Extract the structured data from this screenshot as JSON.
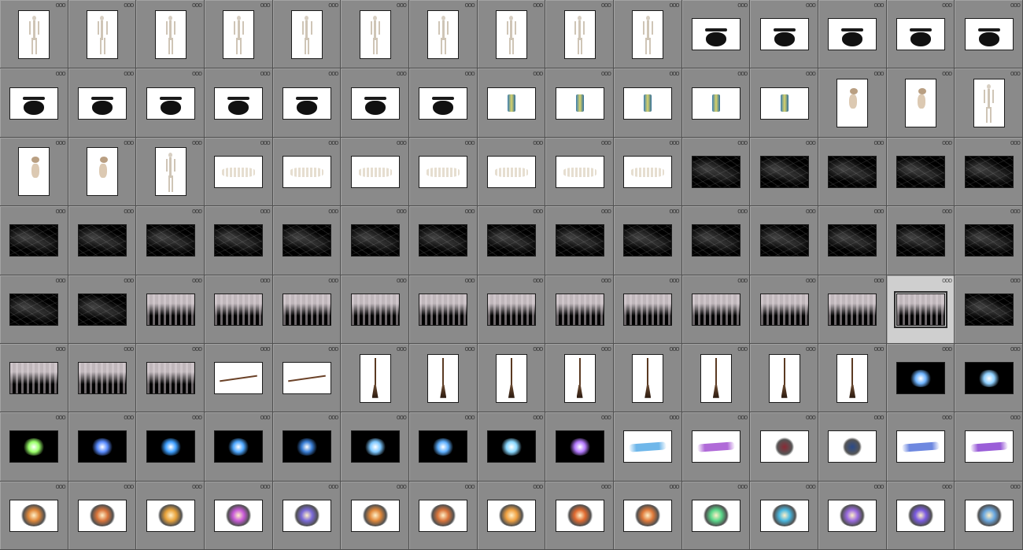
{
  "grid": {
    "columns": 15,
    "rows": 8,
    "menu_glyph": "ooo",
    "selected_index": 73
  },
  "thumbnails": [
    {
      "kind": "skeleton",
      "orient": "portrait",
      "bg": "white"
    },
    {
      "kind": "skeleton",
      "orient": "portrait",
      "bg": "white"
    },
    {
      "kind": "skeleton",
      "orient": "portrait",
      "bg": "white"
    },
    {
      "kind": "skeleton",
      "orient": "portrait",
      "bg": "white"
    },
    {
      "kind": "skeleton",
      "orient": "portrait",
      "bg": "white"
    },
    {
      "kind": "skeleton",
      "orient": "portrait",
      "bg": "white"
    },
    {
      "kind": "skeleton",
      "orient": "portrait",
      "bg": "white"
    },
    {
      "kind": "skeleton",
      "orient": "portrait",
      "bg": "white"
    },
    {
      "kind": "skeleton",
      "orient": "portrait",
      "bg": "white"
    },
    {
      "kind": "skeleton",
      "orient": "portrait",
      "bg": "white"
    },
    {
      "kind": "cauldron",
      "orient": "landscape",
      "bg": "white"
    },
    {
      "kind": "cauldron",
      "orient": "landscape",
      "bg": "white"
    },
    {
      "kind": "cauldron",
      "orient": "landscape",
      "bg": "white"
    },
    {
      "kind": "cauldron",
      "orient": "landscape",
      "bg": "white"
    },
    {
      "kind": "cauldron",
      "orient": "landscape",
      "bg": "white"
    },
    {
      "kind": "cauldron",
      "orient": "landscape",
      "bg": "white"
    },
    {
      "kind": "cauldron",
      "orient": "landscape",
      "bg": "white"
    },
    {
      "kind": "cauldron",
      "orient": "landscape",
      "bg": "white"
    },
    {
      "kind": "cauldron",
      "orient": "landscape",
      "bg": "white"
    },
    {
      "kind": "cauldron",
      "orient": "landscape",
      "bg": "white"
    },
    {
      "kind": "cauldron",
      "orient": "landscape",
      "bg": "white"
    },
    {
      "kind": "cauldron",
      "orient": "landscape",
      "bg": "white"
    },
    {
      "kind": "lantern",
      "orient": "landscape",
      "bg": "white"
    },
    {
      "kind": "lantern",
      "orient": "landscape",
      "bg": "white"
    },
    {
      "kind": "lantern",
      "orient": "landscape",
      "bg": "white"
    },
    {
      "kind": "lantern",
      "orient": "landscape",
      "bg": "white"
    },
    {
      "kind": "lantern",
      "orient": "landscape",
      "bg": "white"
    },
    {
      "kind": "bird-skeleton",
      "orient": "portrait",
      "bg": "white"
    },
    {
      "kind": "bird-skeleton",
      "orient": "portrait",
      "bg": "white"
    },
    {
      "kind": "skeleton",
      "orient": "portrait",
      "bg": "white"
    },
    {
      "kind": "bird-skeleton",
      "orient": "portrait",
      "bg": "white"
    },
    {
      "kind": "bird-skeleton",
      "orient": "portrait",
      "bg": "white"
    },
    {
      "kind": "skeleton",
      "orient": "portrait",
      "bg": "white"
    },
    {
      "kind": "dog-skeleton",
      "orient": "landscape",
      "bg": "white"
    },
    {
      "kind": "dog-skeleton",
      "orient": "landscape",
      "bg": "white"
    },
    {
      "kind": "dog-skeleton",
      "orient": "landscape",
      "bg": "white"
    },
    {
      "kind": "dog-skeleton",
      "orient": "landscape",
      "bg": "white"
    },
    {
      "kind": "dog-skeleton",
      "orient": "landscape",
      "bg": "white"
    },
    {
      "kind": "dog-skeleton",
      "orient": "landscape",
      "bg": "white"
    },
    {
      "kind": "dog-skeleton",
      "orient": "landscape",
      "bg": "white"
    },
    {
      "kind": "cobweb",
      "orient": "landscape",
      "bg": "black"
    },
    {
      "kind": "cobweb",
      "orient": "landscape",
      "bg": "black"
    },
    {
      "kind": "cobweb",
      "orient": "landscape",
      "bg": "black"
    },
    {
      "kind": "cobweb",
      "orient": "landscape",
      "bg": "black"
    },
    {
      "kind": "cobweb",
      "orient": "landscape",
      "bg": "black"
    },
    {
      "kind": "cobweb",
      "orient": "landscape",
      "bg": "black"
    },
    {
      "kind": "cobweb",
      "orient": "landscape",
      "bg": "black"
    },
    {
      "kind": "cobweb",
      "orient": "landscape",
      "bg": "black"
    },
    {
      "kind": "cobweb",
      "orient": "landscape",
      "bg": "black"
    },
    {
      "kind": "cobweb",
      "orient": "landscape",
      "bg": "black"
    },
    {
      "kind": "cobweb",
      "orient": "landscape",
      "bg": "black"
    },
    {
      "kind": "cobweb",
      "orient": "landscape",
      "bg": "black"
    },
    {
      "kind": "cobweb",
      "orient": "landscape",
      "bg": "black"
    },
    {
      "kind": "cobweb",
      "orient": "landscape",
      "bg": "black"
    },
    {
      "kind": "cobweb",
      "orient": "landscape",
      "bg": "black"
    },
    {
      "kind": "cobweb",
      "orient": "landscape",
      "bg": "black"
    },
    {
      "kind": "cobweb",
      "orient": "landscape",
      "bg": "black"
    },
    {
      "kind": "cobweb",
      "orient": "landscape",
      "bg": "black"
    },
    {
      "kind": "cobweb",
      "orient": "landscape",
      "bg": "black"
    },
    {
      "kind": "cobweb",
      "orient": "landscape",
      "bg": "black"
    },
    {
      "kind": "cobweb",
      "orient": "landscape",
      "bg": "black"
    },
    {
      "kind": "cobweb",
      "orient": "landscape",
      "bg": "black"
    },
    {
      "kind": "cheesecloth",
      "orient": "landscape",
      "bg": "black"
    },
    {
      "kind": "cheesecloth",
      "orient": "landscape",
      "bg": "black"
    },
    {
      "kind": "cheesecloth",
      "orient": "landscape",
      "bg": "black"
    },
    {
      "kind": "cheesecloth",
      "orient": "landscape",
      "bg": "black"
    },
    {
      "kind": "cheesecloth",
      "orient": "landscape",
      "bg": "black"
    },
    {
      "kind": "cheesecloth",
      "orient": "landscape",
      "bg": "black"
    },
    {
      "kind": "cheesecloth",
      "orient": "landscape",
      "bg": "black"
    },
    {
      "kind": "cheesecloth",
      "orient": "landscape",
      "bg": "black"
    },
    {
      "kind": "cheesecloth",
      "orient": "landscape",
      "bg": "black"
    },
    {
      "kind": "cheesecloth",
      "orient": "landscape",
      "bg": "black"
    },
    {
      "kind": "cheesecloth",
      "orient": "landscape",
      "bg": "black"
    },
    {
      "kind": "cheesecloth",
      "orient": "landscape",
      "bg": "black"
    },
    {
      "kind": "cobweb",
      "orient": "landscape",
      "bg": "black"
    },
    {
      "kind": "cheesecloth",
      "orient": "landscape",
      "bg": "black"
    },
    {
      "kind": "cheesecloth",
      "orient": "landscape",
      "bg": "black"
    },
    {
      "kind": "cheesecloth",
      "orient": "landscape",
      "bg": "black"
    },
    {
      "kind": "broom-horizontal",
      "orient": "landscape",
      "bg": "white"
    },
    {
      "kind": "broom-horizontal",
      "orient": "landscape",
      "bg": "white"
    },
    {
      "kind": "broom",
      "orient": "portrait",
      "bg": "white"
    },
    {
      "kind": "broom",
      "orient": "portrait",
      "bg": "white"
    },
    {
      "kind": "broom",
      "orient": "portrait",
      "bg": "white"
    },
    {
      "kind": "broom",
      "orient": "portrait",
      "bg": "white"
    },
    {
      "kind": "broom",
      "orient": "portrait",
      "bg": "white"
    },
    {
      "kind": "broom",
      "orient": "portrait",
      "bg": "white"
    },
    {
      "kind": "broom",
      "orient": "portrait",
      "bg": "white"
    },
    {
      "kind": "broom",
      "orient": "portrait",
      "bg": "white"
    },
    {
      "kind": "glow",
      "orient": "landscape",
      "bg": "black",
      "color": "#6fb4ff"
    },
    {
      "kind": "glow",
      "orient": "landscape",
      "bg": "black",
      "color": "#8fd0ff"
    },
    {
      "kind": "glow",
      "orient": "landscape",
      "bg": "black",
      "color": "#9aff6a"
    },
    {
      "kind": "glow",
      "orient": "landscape",
      "bg": "black",
      "color": "#5a8cff"
    },
    {
      "kind": "glow",
      "orient": "landscape",
      "bg": "black",
      "color": "#3fa0ff"
    },
    {
      "kind": "glow",
      "orient": "landscape",
      "bg": "black",
      "color": "#4fa8ff"
    },
    {
      "kind": "glow",
      "orient": "landscape",
      "bg": "black",
      "color": "#3b7fd6"
    },
    {
      "kind": "glow",
      "orient": "landscape",
      "bg": "black",
      "color": "#7ec8ff"
    },
    {
      "kind": "glow",
      "orient": "landscape",
      "bg": "black",
      "color": "#5fb0ff"
    },
    {
      "kind": "glow",
      "orient": "landscape",
      "bg": "black",
      "color": "#8ad8ff"
    },
    {
      "kind": "glow",
      "orient": "landscape",
      "bg": "black",
      "color": "#b57bff"
    },
    {
      "kind": "streak",
      "orient": "landscape",
      "bg": "white",
      "color": "#6fb7ea"
    },
    {
      "kind": "streak",
      "orient": "landscape",
      "bg": "white",
      "color": "#b06ad8"
    },
    {
      "kind": "splat",
      "orient": "landscape",
      "bg": "white",
      "color": "#8a2a35"
    },
    {
      "kind": "splat",
      "orient": "landscape",
      "bg": "white",
      "color": "#2a4a8a"
    },
    {
      "kind": "streak",
      "orient": "landscape",
      "bg": "white",
      "color": "#6e88e0"
    },
    {
      "kind": "streak",
      "orient": "landscape",
      "bg": "white",
      "color": "#9a5ed8"
    },
    {
      "kind": "explosion",
      "orient": "landscape",
      "bg": "white",
      "color": "#e0883a"
    },
    {
      "kind": "explosion",
      "orient": "landscape",
      "bg": "white",
      "color": "#d9743a"
    },
    {
      "kind": "explosion",
      "orient": "landscape",
      "bg": "white",
      "color": "#e8a23a"
    },
    {
      "kind": "explosion",
      "orient": "landscape",
      "bg": "white",
      "color": "#c85ad8"
    },
    {
      "kind": "explosion",
      "orient": "landscape",
      "bg": "white",
      "color": "#7a6ad8"
    },
    {
      "kind": "explosion",
      "orient": "landscape",
      "bg": "white",
      "color": "#e0883a"
    },
    {
      "kind": "explosion",
      "orient": "landscape",
      "bg": "white",
      "color": "#d9743a"
    },
    {
      "kind": "explosion",
      "orient": "landscape",
      "bg": "white",
      "color": "#f0a040"
    },
    {
      "kind": "explosion",
      "orient": "landscape",
      "bg": "white",
      "color": "#e06a30"
    },
    {
      "kind": "explosion",
      "orient": "landscape",
      "bg": "white",
      "color": "#e07a3a"
    },
    {
      "kind": "explosion",
      "orient": "landscape",
      "bg": "white",
      "color": "#5ad88a"
    },
    {
      "kind": "explosion",
      "orient": "landscape",
      "bg": "white",
      "color": "#4ab8e0"
    },
    {
      "kind": "explosion",
      "orient": "landscape",
      "bg": "white",
      "color": "#9a6ae0"
    },
    {
      "kind": "explosion",
      "orient": "landscape",
      "bg": "white",
      "color": "#7a5ae0"
    },
    {
      "kind": "explosion",
      "orient": "landscape",
      "bg": "white",
      "color": "#6aa8e0"
    }
  ]
}
